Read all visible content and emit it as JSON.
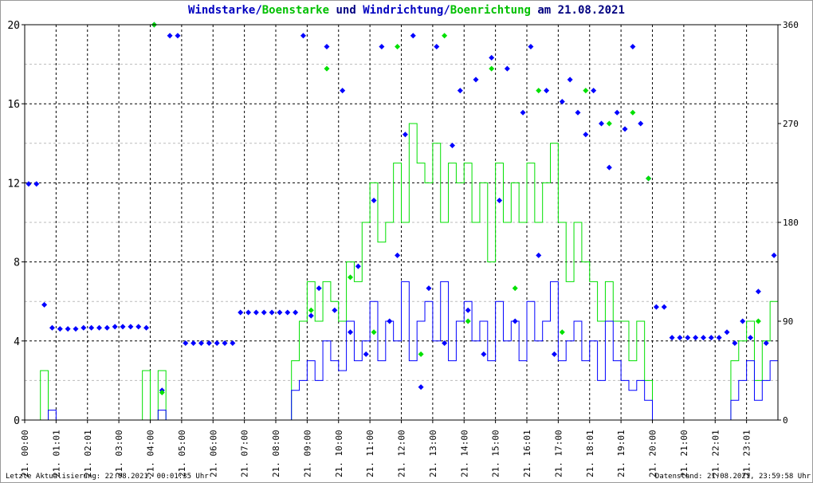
{
  "title": {
    "part1": "Windstarke",
    "sep1": "/",
    "part2": "Boenstarke",
    "mid": " und ",
    "part3": "Windrichtung",
    "sep2": "/",
    "part4": "Boenrichtung",
    "tail": " am 21.08.2021"
  },
  "colors": {
    "wind": "#0000ff",
    "gust": "#00e000",
    "grid": "#000000",
    "text": "#000080"
  },
  "footer": {
    "left": "Letzte Aktualisierung: 22.08.2021, 00:01:35 Uhr",
    "right": "Datenstand: 21.08.2021, 23:59:58 Uhr"
  },
  "chart_data": {
    "type": "line",
    "title": "Windstarke/Boenstarke und Windrichtung/Boenrichtung am 21.08.2021",
    "x_unit": "hours (15-minute steps)",
    "xlim": [
      0,
      24
    ],
    "ylim_left": [
      0,
      20
    ],
    "ylim_right": [
      0,
      360
    ],
    "yticks_left": [
      "0",
      "4",
      "8",
      "12",
      "16",
      "20"
    ],
    "yticks_right": [
      "0",
      "90",
      "180",
      "270",
      "360"
    ],
    "xticks": [
      "21. 00:00",
      "21. 01:01",
      "21. 02:01",
      "21. 03:00",
      "21. 04:00",
      "21. 05:00",
      "21. 06:00",
      "21. 07:00",
      "21. 08:00",
      "21. 09:00",
      "21. 10:00",
      "21. 11:00",
      "21. 12:00",
      "21. 13:00",
      "21. 14:00",
      "21. 15:00",
      "21. 16:01",
      "21. 17:00",
      "21. 18:01",
      "21. 19:01",
      "21. 20:00",
      "21. 21:00",
      "21. 22:01",
      "21. 23:01"
    ],
    "grid": true,
    "series": [
      {
        "name": "Windstarke",
        "axis": "left",
        "kind": "line",
        "values": [
          0,
          0,
          0,
          0.5,
          0,
          0,
          0,
          0,
          0,
          0,
          0,
          0,
          0,
          0,
          0,
          0,
          0,
          0.5,
          0,
          0,
          0,
          0,
          0,
          0,
          0,
          0,
          0,
          0,
          0,
          0,
          0,
          0,
          0,
          0,
          1.5,
          2,
          3,
          2,
          4,
          3,
          2.5,
          5,
          3,
          4,
          6,
          3,
          5,
          4,
          7,
          3,
          5,
          6,
          4,
          7,
          3,
          5,
          6,
          4,
          5,
          3,
          6,
          4,
          5,
          3,
          6,
          4,
          5,
          7,
          3,
          4,
          5,
          3,
          4,
          2,
          5,
          3,
          2,
          1.5,
          2,
          1,
          0,
          0,
          0,
          0,
          0,
          0,
          0,
          0,
          0,
          0,
          1,
          2,
          3,
          1,
          2,
          3
        ]
      },
      {
        "name": "Boenstarke",
        "axis": "left",
        "kind": "line",
        "values": [
          0,
          0,
          2.5,
          0,
          0,
          0,
          0,
          0,
          0,
          0,
          0,
          0,
          0,
          0,
          0,
          2.5,
          0,
          2.5,
          0,
          0,
          0,
          0,
          0,
          0,
          0,
          0,
          0,
          0,
          0,
          0,
          0,
          0,
          0,
          0,
          3,
          5,
          7,
          5,
          7,
          6,
          5,
          8,
          7,
          10,
          12,
          9,
          10,
          13,
          10,
          15,
          13,
          12,
          14,
          10,
          13,
          12,
          13,
          10,
          12,
          8,
          13,
          10,
          12,
          10,
          13,
          10,
          12,
          14,
          10,
          7,
          10,
          8,
          7,
          5,
          7,
          5,
          5,
          3,
          5,
          2,
          0,
          0,
          0,
          0,
          0,
          0,
          0,
          0,
          0,
          0,
          3,
          4,
          5,
          2,
          4,
          6
        ]
      },
      {
        "name": "Windrichtung",
        "axis": "right",
        "kind": "scatter",
        "values": [
          215,
          215,
          105,
          84,
          83,
          83,
          83,
          84,
          84,
          84,
          84,
          85,
          85,
          85,
          85,
          84,
          360,
          27,
          350,
          350,
          70,
          70,
          70,
          70,
          70,
          70,
          70,
          98,
          98,
          98,
          98,
          98,
          98,
          98,
          98,
          350,
          95,
          120,
          340,
          100,
          300,
          80,
          140,
          60,
          200,
          340,
          90,
          150,
          260,
          350,
          30,
          120,
          340,
          70,
          250,
          300,
          100,
          310,
          60,
          330,
          200,
          320,
          90,
          280,
          340,
          150,
          300,
          60,
          290,
          310,
          280,
          260,
          300,
          270,
          230,
          280,
          265,
          340,
          270,
          220,
          103,
          103,
          75,
          75,
          75,
          75,
          75,
          75,
          75,
          80,
          70,
          90,
          75,
          117,
          70,
          150
        ]
      },
      {
        "name": "Boenrichtung",
        "axis": "right",
        "kind": "scatter",
        "values": [
          null,
          null,
          null,
          null,
          null,
          null,
          null,
          null,
          null,
          null,
          null,
          null,
          null,
          null,
          null,
          null,
          360,
          25,
          null,
          null,
          null,
          null,
          null,
          null,
          null,
          null,
          null,
          null,
          null,
          null,
          null,
          null,
          null,
          null,
          null,
          null,
          100,
          null,
          320,
          null,
          null,
          130,
          null,
          null,
          80,
          null,
          null,
          340,
          null,
          null,
          60,
          null,
          null,
          350,
          null,
          null,
          90,
          null,
          null,
          320,
          null,
          null,
          120,
          null,
          null,
          300,
          null,
          null,
          80,
          null,
          null,
          300,
          null,
          null,
          270,
          null,
          null,
          280,
          null,
          220,
          null,
          null,
          null,
          null,
          null,
          null,
          null,
          null,
          null,
          null,
          null,
          null,
          null,
          90,
          null,
          null
        ]
      }
    ]
  }
}
